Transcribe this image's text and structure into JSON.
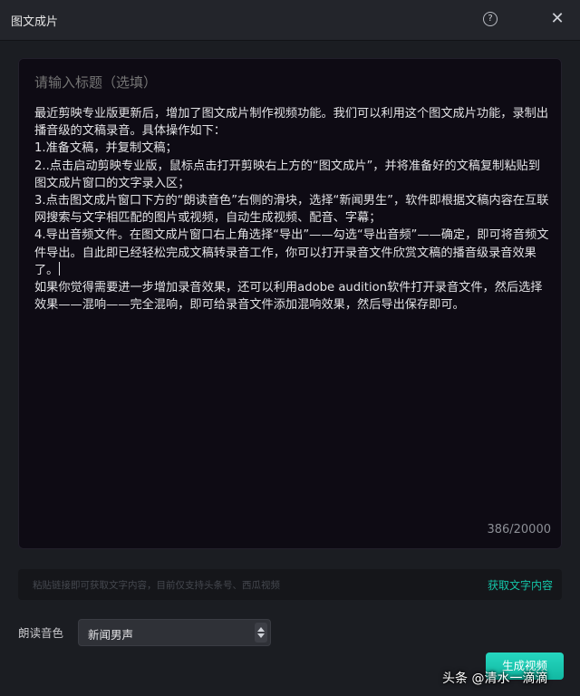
{
  "window": {
    "title": "图文成片",
    "help_glyph": "?",
    "close_glyph": "✕"
  },
  "editor": {
    "title_placeholder": "请输入标题（选填）",
    "paragraphs": [
      "最近剪映专业版更新后，增加了图文成片制作视频功能。我们可以利用这个图文成片功能，录制出播音级的文稿录音。具体操作如下：",
      "1.准备文稿，并复制文稿；",
      "2..点击启动剪映专业版，鼠标点击打开剪映右上方的“图文成片”，并将准备好的文稿复制粘贴到图文成片窗口的文字录入区；",
      "3.点击图文成片窗口下方的“朗读音色”右侧的滑块，选择“新闻男生”，软件即根据文稿内容在互联网搜索与文字相匹配的图片或视频，自动生成视频、配音、字幕；",
      "4.导出音频文件。在图文成片窗口右上角选择“导出”——勾选“导出音频”——确定，即可将音频文件导出。自此即已经轻松完成文稿转录音工作，你可以打开录音文件欣赏文稿的播音级录音效果了。",
      "如果你觉得需要进一步增加录音效果，还可以利用adobe audition软件打开录音文件，然后选择效果——混响——完全混响，即可给录音文件添加混响效果，然后导出保存即可。"
    ],
    "char_count": "386/20000"
  },
  "url_bar": {
    "placeholder": "粘贴链接即可获取文字内容，目前仅支持头条号、西瓜视频",
    "fetch_label": "获取文字内容"
  },
  "voice": {
    "label": "朗读音色",
    "selected": "新闻男声"
  },
  "generate_label": "生成视频",
  "watermark": "头条 @清水一滴滴",
  "colors": {
    "accent": "#14c6a9",
    "background": "#1b1d22",
    "editor_bg": "#0e0b14"
  }
}
